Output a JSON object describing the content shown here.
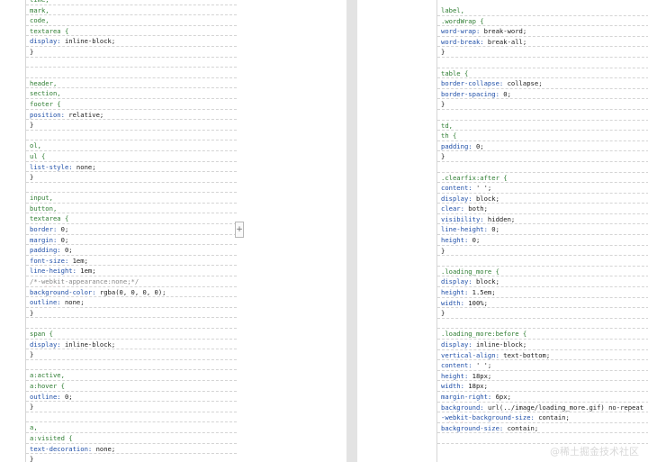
{
  "colors": {
    "selector": "#2e7d32",
    "property": "#1f4fa8",
    "value": "#202020",
    "comment": "#8a8a8a",
    "divider": "#e3e3e3"
  },
  "left_page": {
    "lines": [
      {
        "t": "time,",
        "k": "sel"
      },
      {
        "t": "mark,",
        "k": "sel"
      },
      {
        "t": "code,",
        "k": "sel"
      },
      {
        "t": "textarea {",
        "k": "sel",
        "u": "textarea"
      },
      {
        "p": "display",
        "v": "inline-block;"
      },
      {
        "t": "}",
        "k": "brace"
      },
      {
        "t": "",
        "k": "blank"
      },
      {
        "t": "",
        "k": "blank"
      },
      {
        "t": "header,",
        "k": "sel"
      },
      {
        "t": "section,",
        "k": "sel"
      },
      {
        "t": "footer {",
        "k": "sel"
      },
      {
        "p": "position",
        "v": "relative;"
      },
      {
        "t": "}",
        "k": "brace"
      },
      {
        "t": "",
        "k": "blank"
      },
      {
        "t": "ol,",
        "k": "sel",
        "u": "ol"
      },
      {
        "t": "ul {",
        "k": "sel",
        "u": "ul"
      },
      {
        "p": "list-style",
        "v": "none;"
      },
      {
        "t": "}",
        "k": "brace"
      },
      {
        "t": "",
        "k": "blank"
      },
      {
        "t": "input,",
        "k": "sel"
      },
      {
        "t": "button,",
        "k": "sel"
      },
      {
        "t": "textarea {",
        "k": "sel",
        "u": "textarea"
      },
      {
        "p": "border",
        "v": "0;"
      },
      {
        "p": "margin",
        "v": "0;"
      },
      {
        "p": "padding",
        "v": "0;"
      },
      {
        "p": "font-size",
        "v": "1em;"
      },
      {
        "p": "line-height",
        "v": "1em;"
      },
      {
        "t": "/*-webkit-appearance:none;*/",
        "k": "comment",
        "u": "webkit"
      },
      {
        "p": "background-color",
        "v": "rgba(0, 0, 0, 0);",
        "u": "rgba"
      },
      {
        "p": "outline",
        "v": "none;"
      },
      {
        "t": "}",
        "k": "brace"
      },
      {
        "t": "",
        "k": "blank"
      },
      {
        "t": "span {",
        "k": "sel"
      },
      {
        "p": "display",
        "v": "inline-block;"
      },
      {
        "t": "}",
        "k": "brace"
      },
      {
        "t": "",
        "k": "blank"
      },
      {
        "t": "a:active,",
        "k": "sel"
      },
      {
        "t": "a:hover {",
        "k": "sel"
      },
      {
        "p": "outline",
        "v": "0;"
      },
      {
        "t": "}",
        "k": "brace"
      },
      {
        "t": "",
        "k": "blank"
      },
      {
        "t": "a,",
        "k": "sel"
      },
      {
        "t": "a:visited {",
        "k": "sel"
      },
      {
        "p": "text-decoration",
        "v": "none;"
      },
      {
        "t": "}",
        "k": "brace"
      }
    ]
  },
  "right_page": {
    "lines": [
      {
        "t": "label,",
        "k": "sel"
      },
      {
        "t": ".wordWrap {",
        "k": "sel",
        "u": "wordWrap"
      },
      {
        "p": "word-wrap",
        "v": "break-word;"
      },
      {
        "p": "word-break",
        "v": "break-all;"
      },
      {
        "t": "}",
        "k": "brace"
      },
      {
        "t": "",
        "k": "blank"
      },
      {
        "t": "table {",
        "k": "sel"
      },
      {
        "p": "border-collapse",
        "v": "collapse;"
      },
      {
        "p": "border-spacing",
        "v": "0;"
      },
      {
        "t": "}",
        "k": "brace"
      },
      {
        "t": "",
        "k": "blank"
      },
      {
        "t": "td,",
        "k": "sel",
        "u": "td"
      },
      {
        "t": "th {",
        "k": "sel"
      },
      {
        "p": "padding",
        "v": "0;"
      },
      {
        "t": "}",
        "k": "brace"
      },
      {
        "t": "",
        "k": "blank"
      },
      {
        "t": ".clearfix:after {",
        "k": "sel",
        "u": "clearfix"
      },
      {
        "p": "content",
        "v": "' ';"
      },
      {
        "p": "display",
        "v": "block;"
      },
      {
        "p": "clear",
        "v": "both;"
      },
      {
        "p": "visibility",
        "v": "hidden;"
      },
      {
        "p": "line-height",
        "v": "0;"
      },
      {
        "p": "height",
        "v": "0;"
      },
      {
        "t": "}",
        "k": "brace"
      },
      {
        "t": "",
        "k": "blank"
      },
      {
        "t": ".loading_more {",
        "k": "sel"
      },
      {
        "p": "display",
        "v": "block;"
      },
      {
        "p": "height",
        "v": "1.5em;"
      },
      {
        "p": "width",
        "v": "100%;"
      },
      {
        "t": "}",
        "k": "brace"
      },
      {
        "t": "",
        "k": "blank"
      },
      {
        "t": ".loading_more:before {",
        "k": "sel"
      },
      {
        "p": "display",
        "v": "inline-block;"
      },
      {
        "p": "vertical-align",
        "v": "text-bottom;"
      },
      {
        "p": "content",
        "v": "' ';"
      },
      {
        "p": "height",
        "v": "18px;"
      },
      {
        "p": "width",
        "v": "18px;"
      },
      {
        "p": "margin-right",
        "v": "6px;"
      },
      {
        "p": "background",
        "v": "url(../image/loading_more.gif) no-repeat center;",
        "u": "url"
      },
      {
        "p": "-webkit-background-size",
        "v": "contain;",
        "u": "webkit"
      },
      {
        "p": "background-size",
        "v": "contain;"
      },
      {
        "t": "",
        "k": "blank"
      }
    ]
  },
  "watermark": "@稀土掘金技术社区",
  "add_button_label": "+"
}
